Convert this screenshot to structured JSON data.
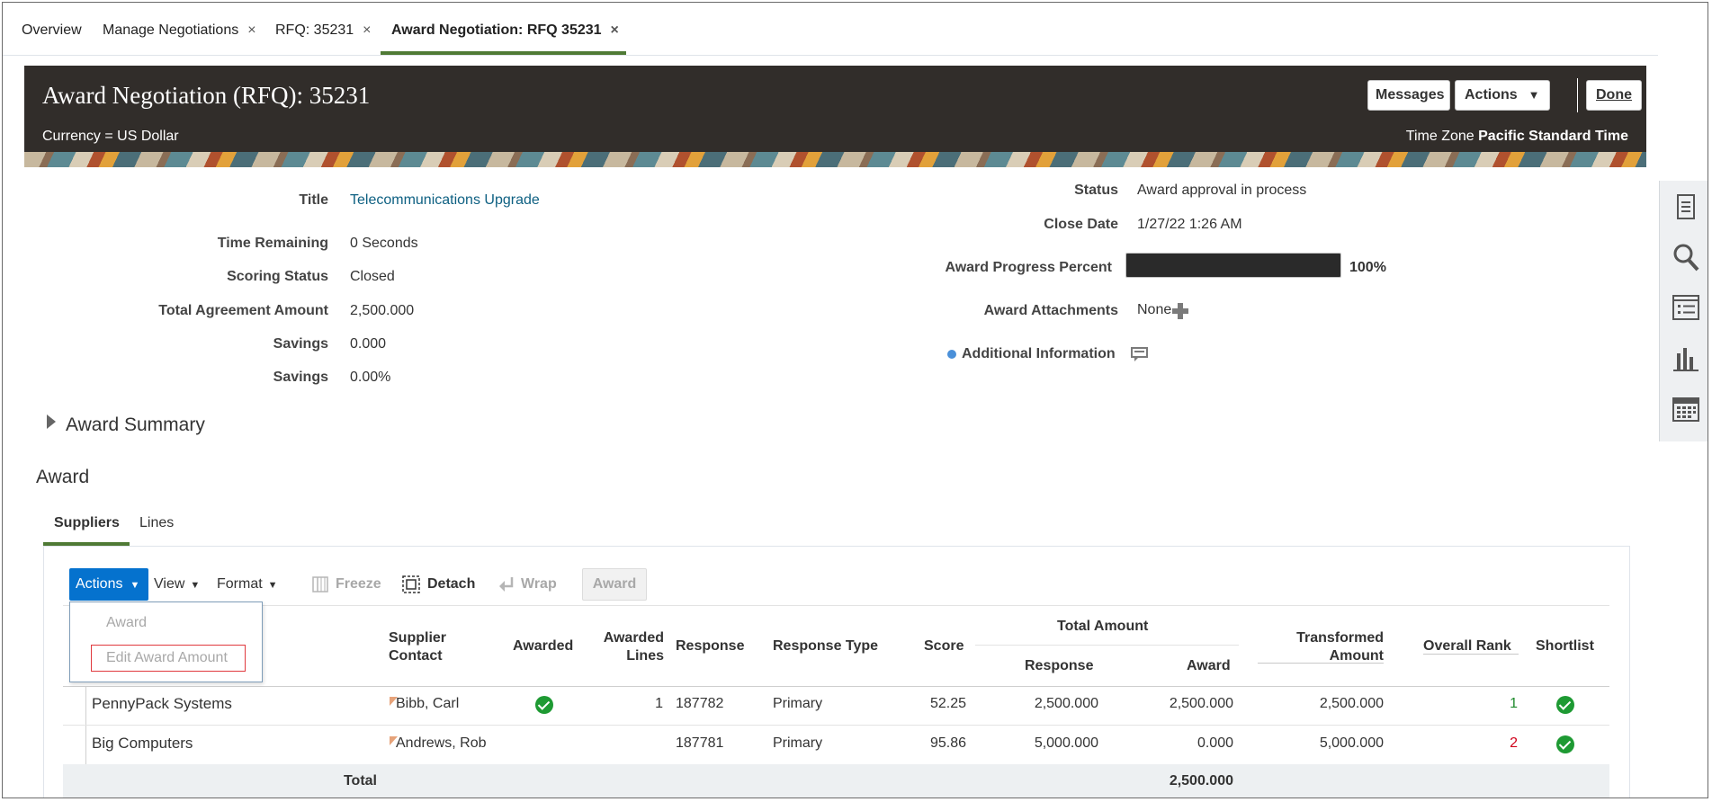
{
  "tabs": [
    {
      "label": "Overview"
    },
    {
      "label": "Manage Negotiations",
      "close": "×"
    },
    {
      "label": "RFQ: 35231",
      "close": "×"
    },
    {
      "label": "Award Negotiation: RFQ 35231",
      "close": "×"
    }
  ],
  "header": {
    "title": "Award Negotiation (RFQ): 35231",
    "currency_label": "Currency = US Dollar",
    "timezone_label": "Time Zone",
    "timezone_value": "Pacific Standard Time",
    "messages_btn": "Messages",
    "actions_btn": "Actions",
    "done_btn": "Done"
  },
  "details": {
    "title_label": "Title",
    "title_value": "Telecommunications Upgrade",
    "time_remaining_label": "Time Remaining",
    "time_remaining_value": "0 Seconds",
    "scoring_status_label": "Scoring Status",
    "scoring_status_value": "Closed",
    "total_agreement_label": "Total Agreement Amount",
    "total_agreement_value": "2,500.000",
    "savings_label": "Savings",
    "savings_value": "0.000",
    "savings_pct_label": "Savings",
    "savings_pct_value": "0.00%",
    "status_label": "Status",
    "status_value": "Award approval in process",
    "close_date_label": "Close Date",
    "close_date_value": "1/27/22 1:26 AM",
    "progress_label": "Award Progress Percent",
    "progress_value": "100%",
    "progress_fraction": 1.0,
    "attachments_label": "Award Attachments",
    "attachments_value": "None",
    "additional_info_label": "Additional Information"
  },
  "award_summary": "Award Summary",
  "award": {
    "heading": "Award",
    "subtabs": [
      "Suppliers",
      "Lines"
    ],
    "toolbar": {
      "actions": "Actions",
      "view": "View",
      "format": "Format",
      "freeze": "Freeze",
      "detach": "Detach",
      "wrap": "Wrap",
      "award": "Award"
    },
    "menu": {
      "award": "Award",
      "edit_award_amount": "Edit Award Amount"
    },
    "columns": {
      "supplier_contact": "Supplier Contact",
      "awarded": "Awarded",
      "awarded_lines": "Awarded Lines",
      "response": "Response",
      "response_type": "Response Type",
      "score": "Score",
      "total_amount": "Total Amount",
      "total_response": "Response",
      "total_award": "Award",
      "transformed_amount": "Transformed Amount",
      "overall_rank": "Overall Rank",
      "shortlist": "Shortlist"
    },
    "rows": [
      {
        "supplier": "PennyPack Systems",
        "contact": "Bibb, Carl",
        "awarded": true,
        "awarded_lines": "1",
        "response": "187782",
        "response_type": "Primary",
        "score": "52.25",
        "total_response": "2,500.000",
        "total_award": "2,500.000",
        "transformed_amount": "2,500.000",
        "rank": "1",
        "shortlist": true
      },
      {
        "supplier": "Big Computers",
        "contact": "Andrews, Rob",
        "awarded": false,
        "awarded_lines": "",
        "response": "187781",
        "response_type": "Primary",
        "score": "95.86",
        "total_response": "5,000.000",
        "total_award": "0.000",
        "transformed_amount": "5,000.000",
        "rank": "2",
        "shortlist": true
      }
    ],
    "total_label": "Total",
    "total_award": "2,500.000"
  },
  "colors": {
    "accent": "#4f7a35",
    "link": "#0e6082",
    "rank1": "#1e8a2c",
    "rank2": "#d0021b",
    "header_bg": "#312d2a"
  }
}
